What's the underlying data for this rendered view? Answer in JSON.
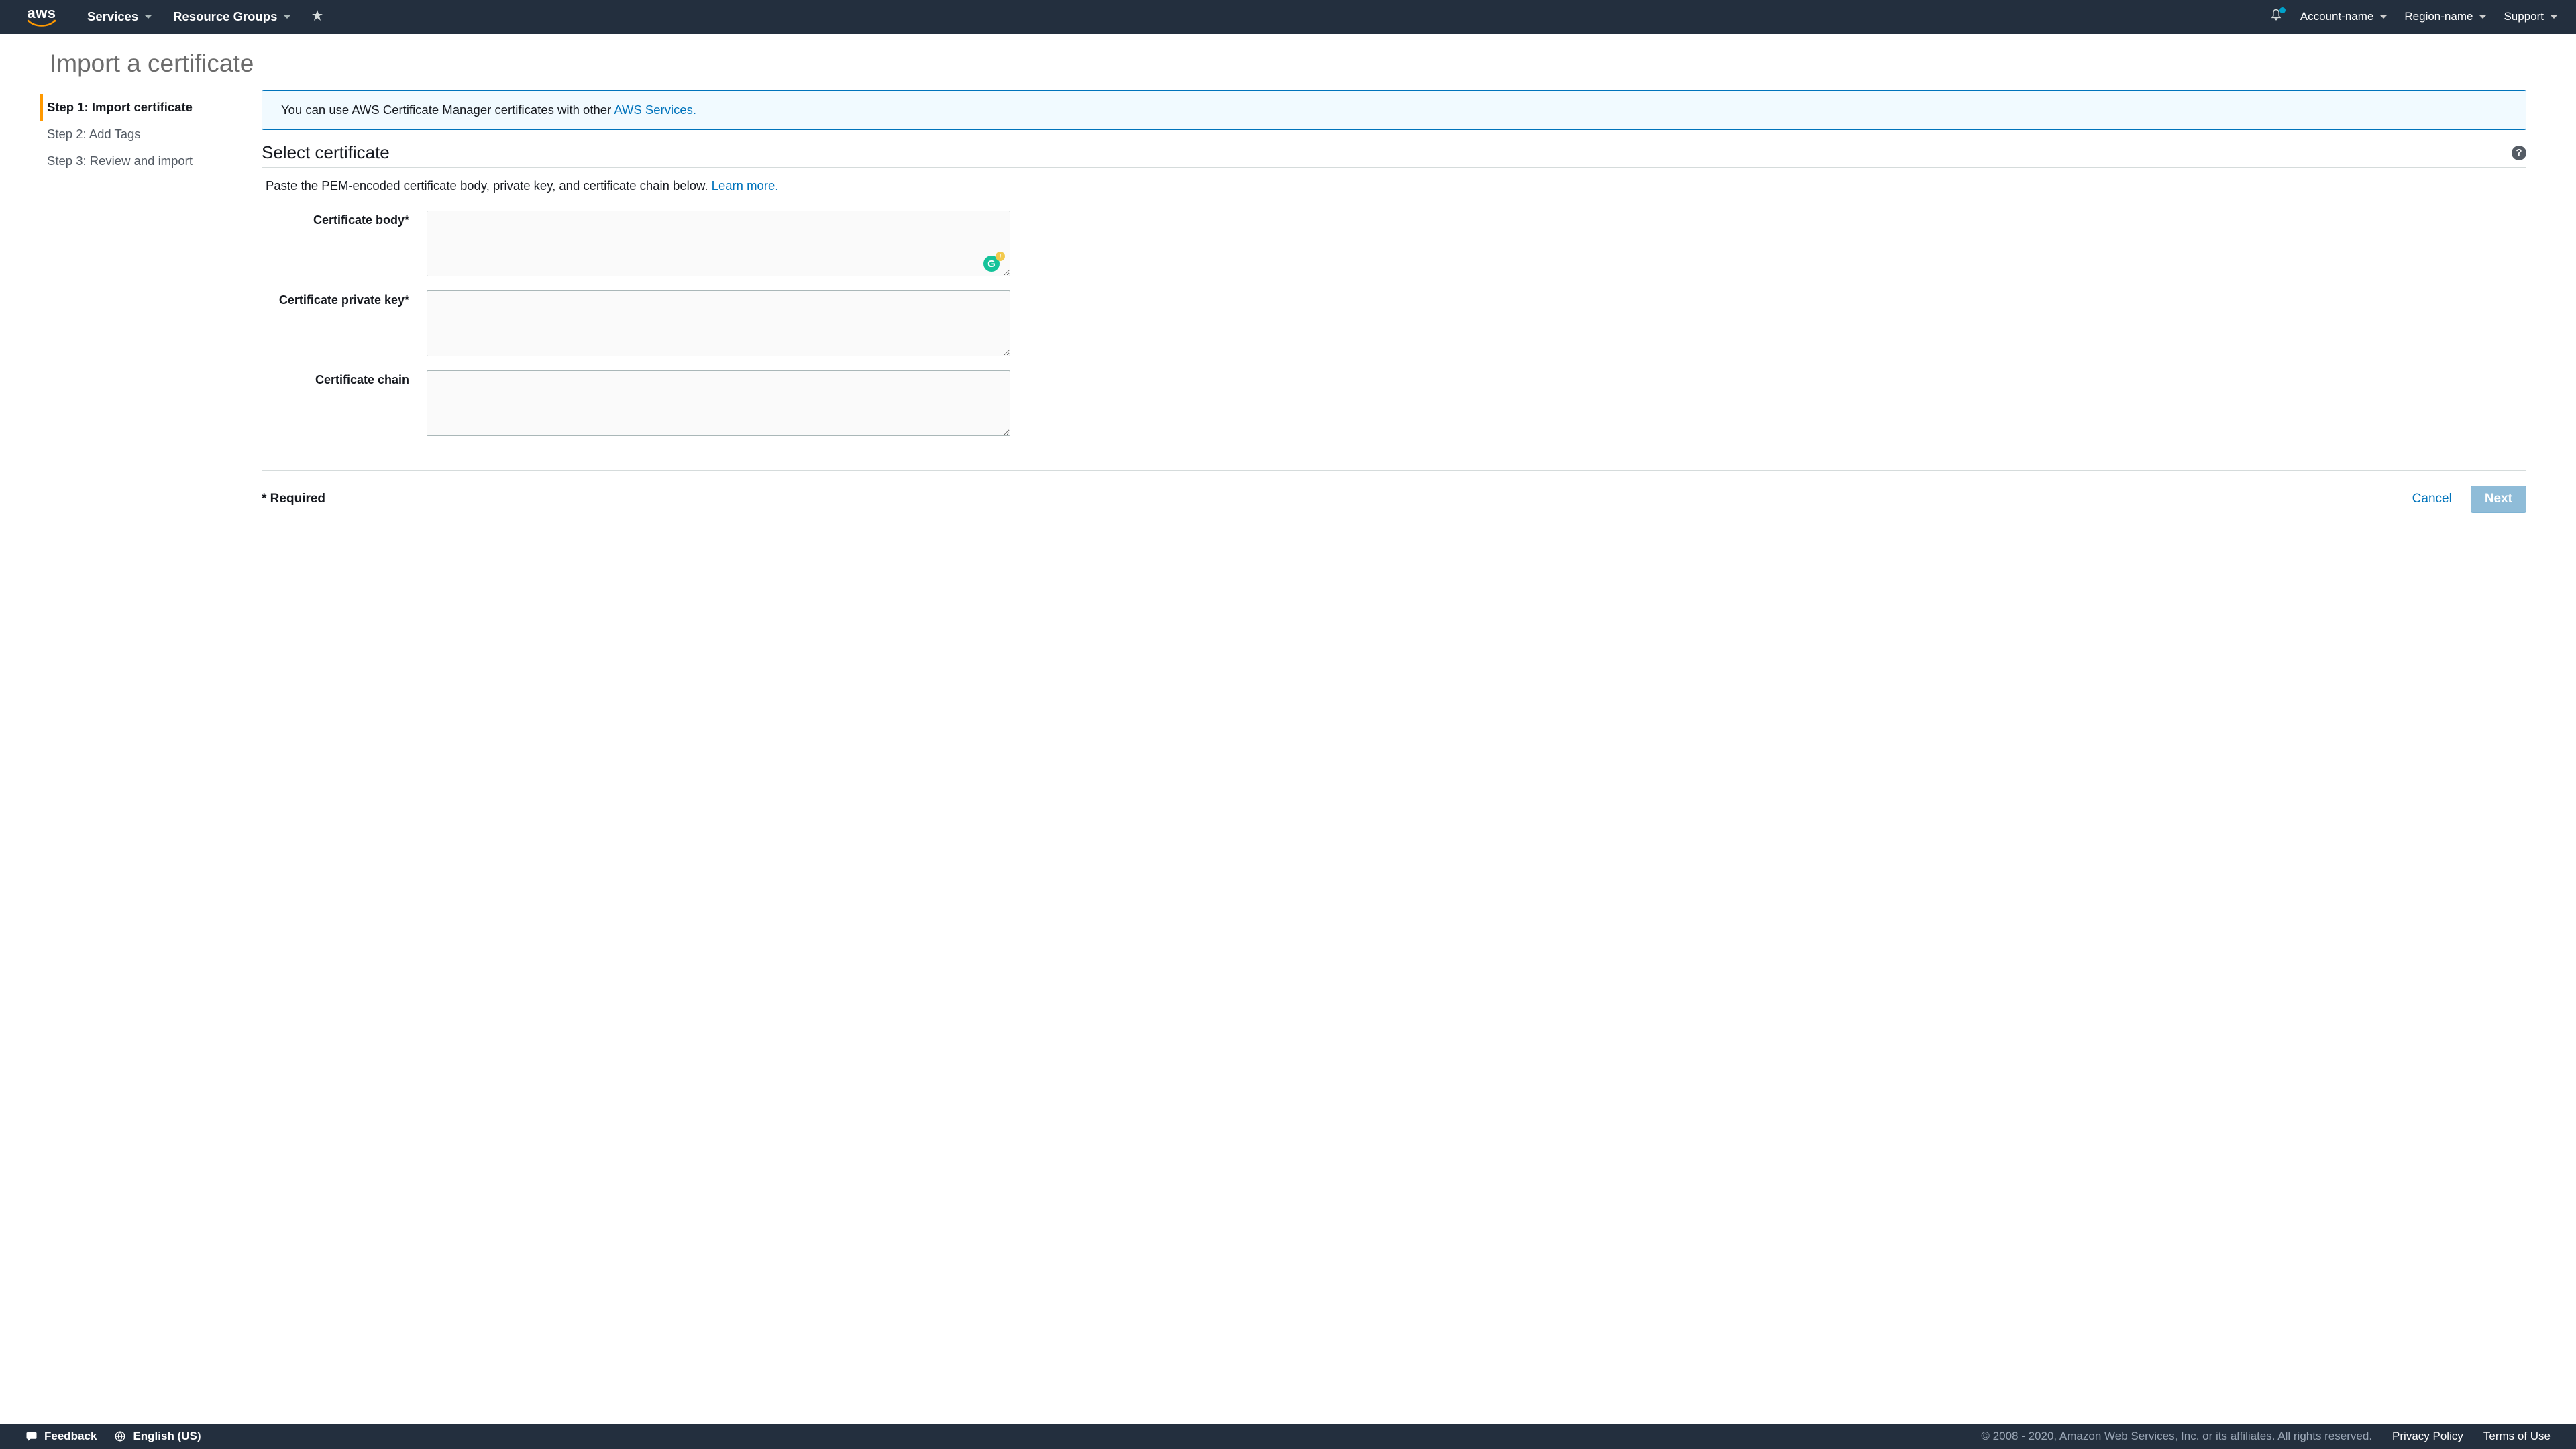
{
  "topnav": {
    "services": "Services",
    "resource_groups": "Resource Groups",
    "account": "Account-name",
    "region": "Region-name",
    "support": "Support"
  },
  "heading": "Import a certificate",
  "steps": [
    {
      "label": "Step 1: Import certificate",
      "active": true
    },
    {
      "label": "Step 2: Add Tags",
      "active": false
    },
    {
      "label": "Step 3: Review and import",
      "active": false
    }
  ],
  "alert": {
    "text": "You can use AWS Certificate Manager certificates with other ",
    "link": "AWS Services."
  },
  "section": {
    "title": "Select certificate",
    "desc": "Paste the PEM-encoded certificate body, private key, and certificate chain below. ",
    "learn_more": "Learn more."
  },
  "form": {
    "cert_body_label": "Certificate body*",
    "cert_body_value": "",
    "priv_key_label": "Certificate private key*",
    "priv_key_value": "",
    "chain_label": "Certificate chain",
    "chain_value": ""
  },
  "footer": {
    "required": "* Required",
    "cancel": "Cancel",
    "next": "Next"
  },
  "bottombar": {
    "feedback": "Feedback",
    "language": "English (US)",
    "copyright": "© 2008 - 2020, Amazon Web Services, Inc. or its affiliates. All rights reserved.",
    "privacy": "Privacy Policy",
    "terms": "Terms of Use"
  }
}
